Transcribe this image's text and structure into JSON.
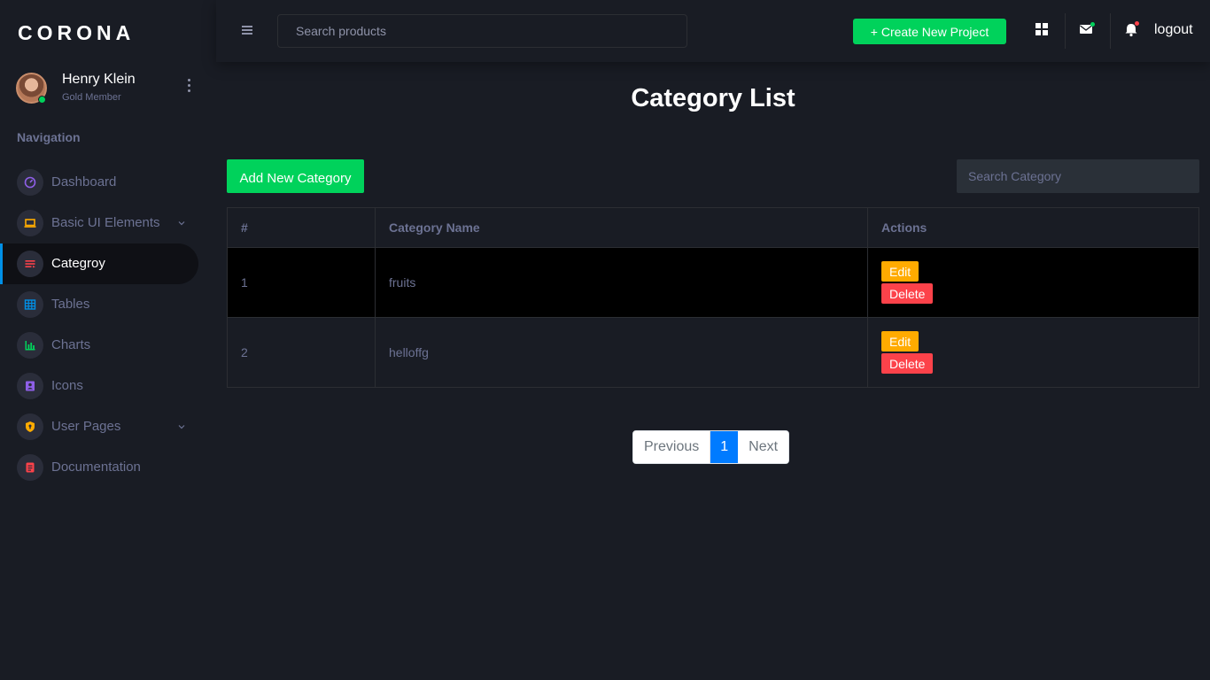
{
  "brand": "CORONA",
  "profile": {
    "name": "Henry Klein",
    "role": "Gold Member"
  },
  "sidebar": {
    "heading": "Navigation",
    "items": [
      {
        "label": "Dashboard",
        "icon": "speedometer-icon",
        "color": "#8f5fe8"
      },
      {
        "label": "Basic UI Elements",
        "icon": "laptop-icon",
        "color": "#ffab00"
      },
      {
        "label": "Categroy",
        "icon": "list-icon",
        "color": "#fc424a",
        "active": true
      },
      {
        "label": "Tables",
        "icon": "table-icon",
        "color": "#0090e7"
      },
      {
        "label": "Charts",
        "icon": "chart-bar-icon",
        "color": "#00d25b"
      },
      {
        "label": "Icons",
        "icon": "contacts-icon",
        "color": "#8f5fe8"
      },
      {
        "label": "User Pages",
        "icon": "security-icon",
        "color": "#ffab00"
      },
      {
        "label": "Documentation",
        "icon": "file-document-icon",
        "color": "#fc424a"
      }
    ]
  },
  "topbar": {
    "search_placeholder": "Search products",
    "create_label": "+ Create New Project",
    "logout_label": "logout"
  },
  "main": {
    "title": "Category List",
    "add_label": "Add New Category",
    "search_placeholder": "Search Category",
    "table": {
      "headers": [
        "#",
        "Category Name",
        "Actions"
      ],
      "rows": [
        {
          "num": "1",
          "name": "fruits",
          "edit": "Edit",
          "delete": "Delete"
        },
        {
          "num": "2",
          "name": "helloffg",
          "edit": "Edit",
          "delete": "Delete"
        }
      ]
    },
    "pagination": {
      "prev": "Previous",
      "current": "1",
      "next": "Next"
    }
  },
  "colors": {
    "background": "#191c24",
    "success": "#00d25b",
    "warning": "#ffab00",
    "danger": "#fc424a",
    "primary": "#007bff",
    "muted": "#6c7293"
  }
}
